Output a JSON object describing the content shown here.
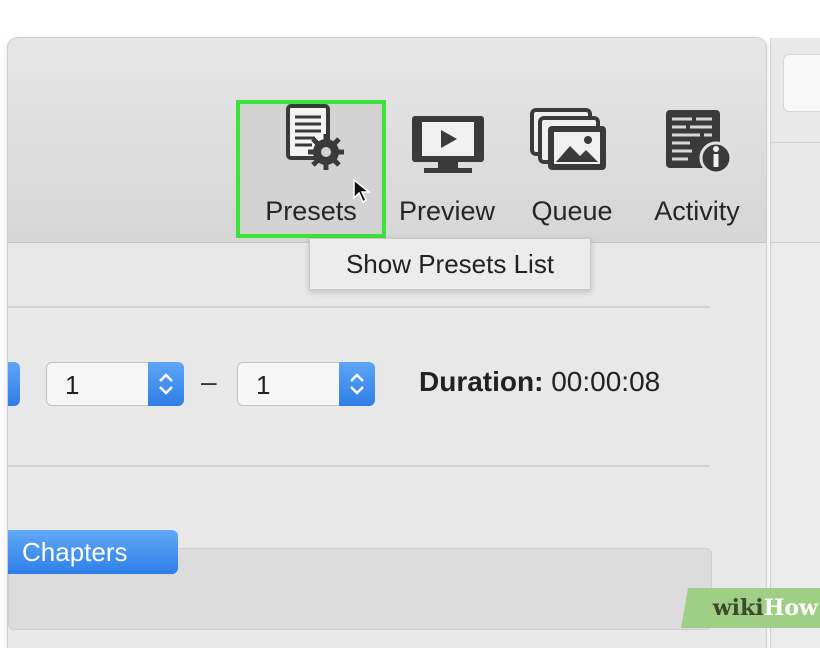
{
  "toolbar": {
    "presets_label": "Presets",
    "preview_label": "Preview",
    "queue_label": "Queue",
    "activity_label": "Activity",
    "highlight_color": "#3de23a"
  },
  "tooltip": {
    "text": "Show Presets List"
  },
  "range": {
    "start_value": "1",
    "separator": "–",
    "end_value": "1",
    "duration_label": "Duration:",
    "duration_value": "00:00:08"
  },
  "tabs": {
    "chapters_label": "Chapters"
  },
  "watermark": {
    "wiki": "wiki",
    "how": "How"
  },
  "icons": [
    "presets-icon",
    "preview-icon",
    "queue-icon",
    "activity-icon",
    "stepper-arrows-icon",
    "cursor-arrow-icon"
  ]
}
